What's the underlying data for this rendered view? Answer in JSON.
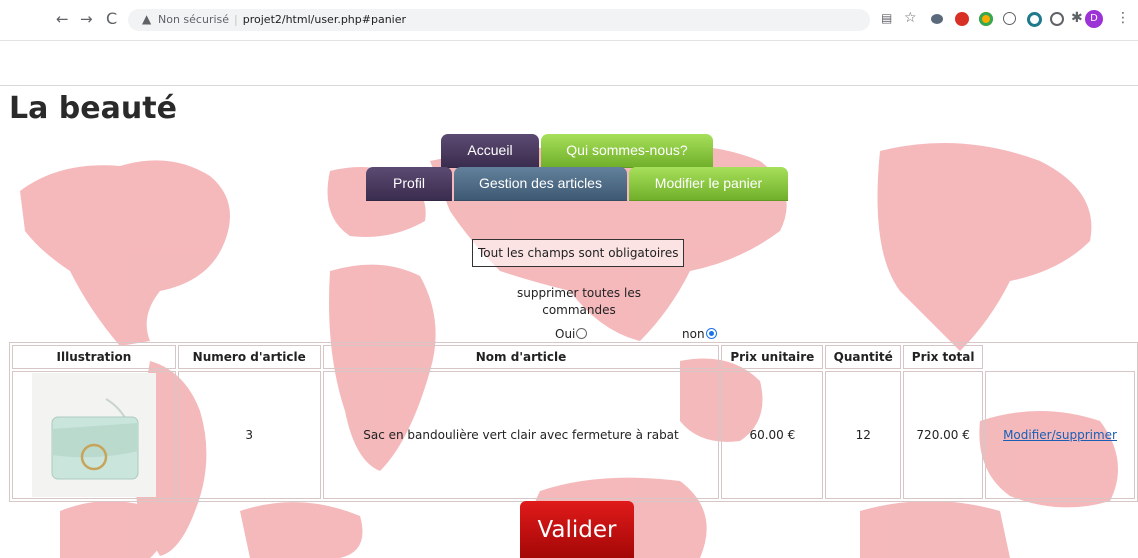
{
  "browser": {
    "security_label": "Non sécurisé",
    "separator": "|",
    "url": "projet2/html/user.php#panier",
    "profile_initial": "D"
  },
  "site": {
    "title": "La beauté"
  },
  "nav": {
    "row1": [
      {
        "label": "Accueil",
        "color": "#3f3052"
      },
      {
        "label": "Qui sommes-nous?",
        "color": "#86c63a"
      }
    ],
    "row2": [
      {
        "label": "Profil",
        "color": "#3f3052"
      },
      {
        "label": "Gestion des articles",
        "color": "#4a657f"
      },
      {
        "label": "Modifier le panier",
        "color": "#86c63a"
      }
    ]
  },
  "form": {
    "notice": "Tout les champs sont obligatoires",
    "delete_all_label": "supprimer toutes les commandes",
    "options": [
      {
        "label": "Oui",
        "checked": false
      },
      {
        "label": "non",
        "checked": true
      }
    ]
  },
  "table": {
    "headers": [
      "Illustration",
      "Numero d'article",
      "Nom d'article",
      "Prix unitaire",
      "Quantité",
      "Prix total",
      ""
    ],
    "rows": [
      {
        "image_alt": "bag-image",
        "numero": "3",
        "nom": "Sac en bandoulière vert clair avec fermeture à rabat",
        "prix_unitaire": "60.00 €",
        "quantite": "12",
        "prix_total": "720.00 €",
        "action": "Modifier/supprimer"
      }
    ]
  },
  "submit_label": "Valider",
  "colors": {
    "accent_red": "#c00b0b",
    "link": "#1a5fb4"
  }
}
